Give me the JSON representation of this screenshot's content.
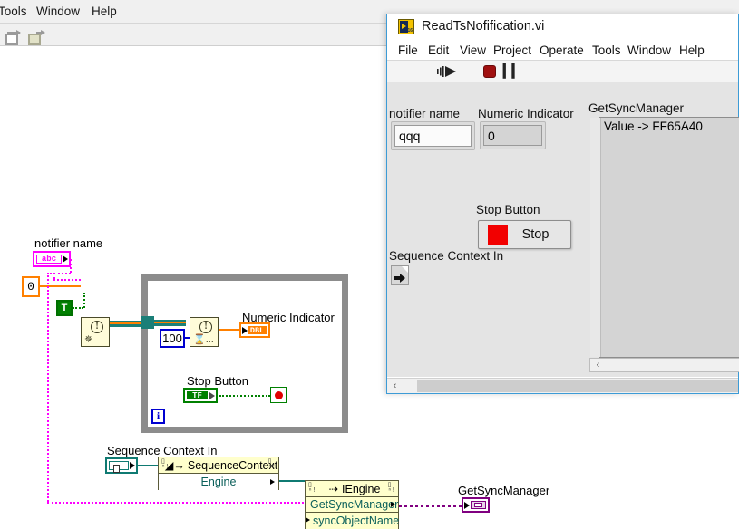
{
  "block_diagram_window": {
    "menus": [
      "Tools",
      "Window",
      "Help"
    ],
    "toolbar": {
      "icons": [
        "align-objects-icon",
        "distribute-objects-icon"
      ]
    },
    "nodes": {
      "notifier_name_label": "notifier name",
      "notifier_name_terminal": "abc",
      "zero_constant": "0",
      "true_constant": "T",
      "obtain_notifier": "obtain-notifier-node",
      "timeout_constant": "100",
      "wait_on_notification": "wait-on-notification-node",
      "numeric_indicator_label": "Numeric Indicator",
      "numeric_indicator_terminal": "DBL",
      "stop_button_label": "Stop Button",
      "stop_button_terminal": "TF",
      "loop_condition_terminal": "stop-if-true-terminal",
      "iteration_terminal": "i",
      "sequence_context_in_label": "Sequence Context In",
      "sequence_context_property_node": {
        "class": "SequenceContext",
        "properties": [
          "Engine"
        ]
      },
      "engine_invoke_node": {
        "class": "IEngine",
        "method": "GetSyncManager",
        "parameters": [
          "syncObjectName"
        ]
      },
      "get_sync_manager_label": "GetSyncManager"
    }
  },
  "front_panel_window": {
    "title": "ReadTsNofification.vi",
    "icon": "labview-vi-icon",
    "menus": [
      "File",
      "Edit",
      "View",
      "Project",
      "Operate",
      "Tools",
      "Window",
      "Help"
    ],
    "toolbar": {
      "run_continuously": "run-continuously-icon",
      "abort": "abort-execution-icon",
      "pause": "pause-icon"
    },
    "controls": {
      "notifier_name": {
        "label": "notifier name",
        "value": "qqq",
        "placeholder": ""
      },
      "numeric_indicator": {
        "label": "Numeric Indicator",
        "value": "0"
      },
      "stop_button": {
        "label": "Stop Button",
        "text": "Stop"
      },
      "sequence_context_in": {
        "label": "Sequence Context In"
      },
      "get_sync_manager": {
        "label": "GetSyncManager",
        "rows": [
          "Value -> FF65A40"
        ]
      }
    },
    "scroll": {
      "left_arrow": "‹"
    }
  },
  "colors": {
    "window_border": "#3c9bd6",
    "panel_bg": "#e4e4e4",
    "string_wire": "#ff00ff",
    "numeric_wire": "#ff8000",
    "boolean_wire": "#008000",
    "refnum_wire": "#1b7f78",
    "activex_wire": "#800080",
    "loop_border": "#8c8c8c",
    "stop_red": "#f20000"
  }
}
